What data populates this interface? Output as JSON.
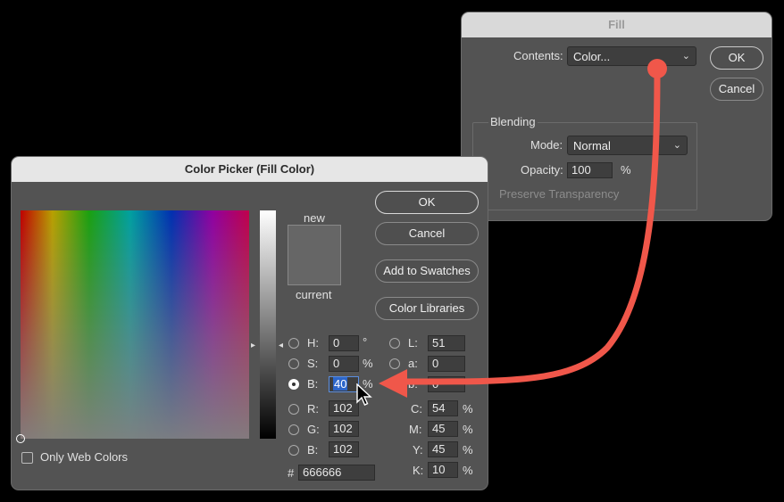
{
  "fill_dialog": {
    "title": "Fill",
    "contents_label": "Contents:",
    "contents_value": "Color...",
    "ok_label": "OK",
    "cancel_label": "Cancel",
    "blending_label": "Blending",
    "mode_label": "Mode:",
    "mode_value": "Normal",
    "opacity_label": "Opacity:",
    "opacity_value": "100",
    "opacity_unit": "%",
    "preserve_transparency_label": "Preserve Transparency"
  },
  "color_picker": {
    "title": "Color Picker (Fill Color)",
    "ok_label": "OK",
    "cancel_label": "Cancel",
    "add_to_swatches_label": "Add to Swatches",
    "color_libraries_label": "Color Libraries",
    "new_label": "new",
    "current_label": "current",
    "only_web_colors_label": "Only Web Colors",
    "hsb": {
      "h_label": "H:",
      "h_value": "0",
      "h_unit": "°",
      "s_label": "S:",
      "s_value": "0",
      "s_unit": "%",
      "b_label": "B:",
      "b_value": "40",
      "b_unit": "%"
    },
    "rgb": {
      "r_label": "R:",
      "r_value": "102",
      "g_label": "G:",
      "g_value": "102",
      "b_label": "B:",
      "b_value": "102"
    },
    "lab": {
      "l_label": "L:",
      "l_value": "51",
      "a_label": "a:",
      "a_value": "0",
      "b_label": "b:",
      "b_value": "0"
    },
    "cmyk": {
      "c_label": "C:",
      "c_value": "54",
      "m_label": "M:",
      "m_value": "45",
      "y_label": "Y:",
      "y_value": "45",
      "k_label": "K:",
      "k_value": "10",
      "unit": "%"
    },
    "hex_label": "#",
    "hex_value": "666666",
    "selected_mode": "B",
    "swatch_color": "#666666"
  },
  "annotation": {
    "arrow_color": "#f0574a"
  }
}
